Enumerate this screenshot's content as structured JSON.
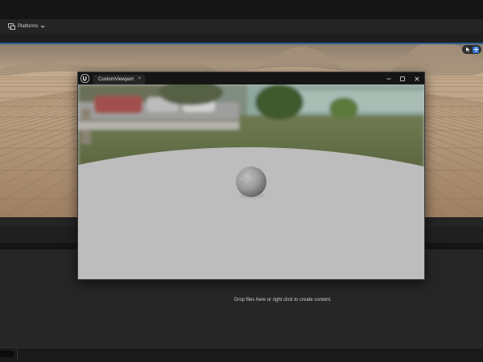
{
  "toolbar": {
    "platforms_label": "Platforms",
    "platforms_icon": "platforms-icon",
    "dropdown_icon": "chevron-down-icon"
  },
  "viewport_tools": {
    "select_icon": "select-cursor-icon",
    "move_icon": "move-arrows-icon",
    "active_tool": "move",
    "accent_color": "#2f6fd0"
  },
  "custom_window": {
    "logo": "unreal-engine-logo-icon",
    "tab_label": "CustomViewport",
    "tab_close": "×",
    "minimize_icon": "minimize-icon",
    "maximize_icon": "maximize-icon",
    "close_icon": "close-icon"
  },
  "content_browser": {
    "drop_hint": "Drop files here or right click to create content."
  }
}
